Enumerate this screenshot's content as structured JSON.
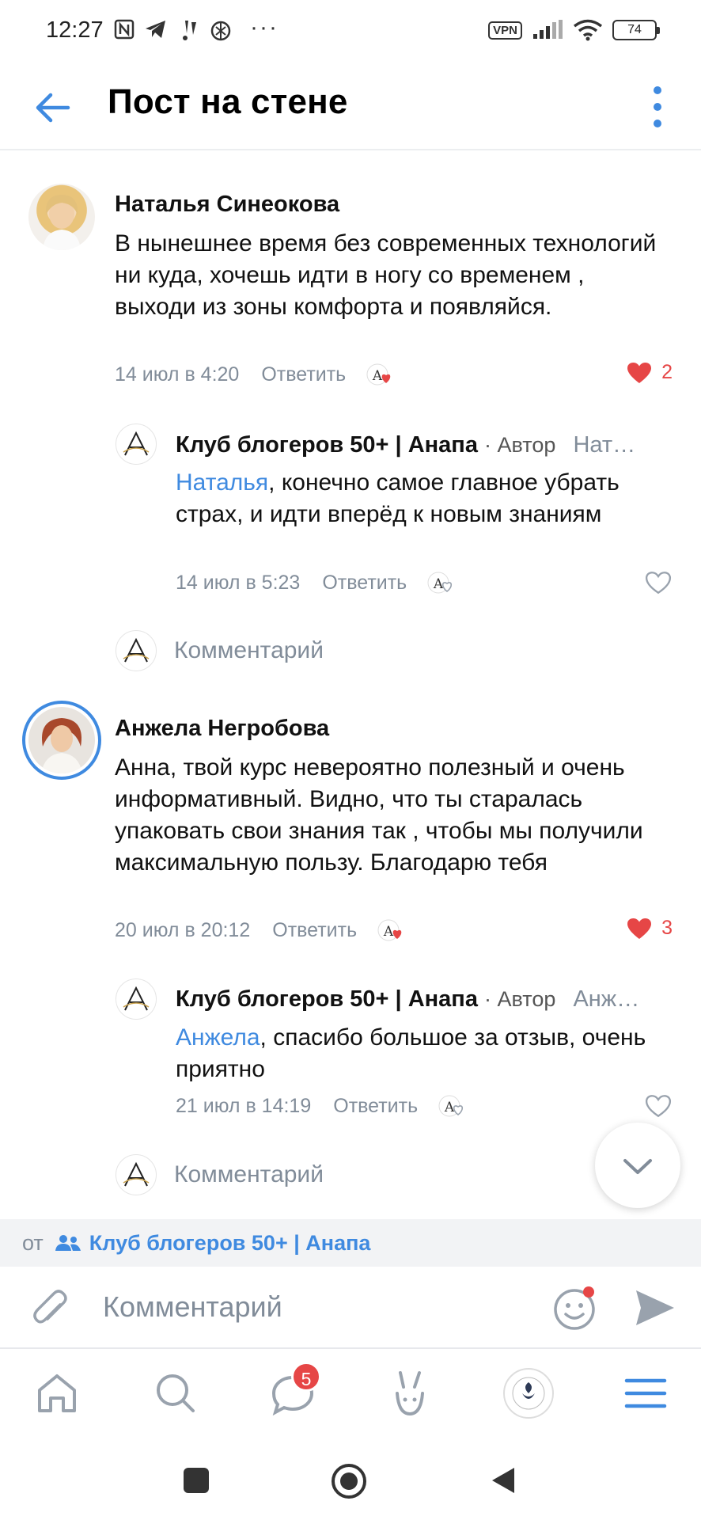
{
  "status_bar": {
    "time": "12:27",
    "vpn": "VPN",
    "battery": "74",
    "dots": "···"
  },
  "header": {
    "title": "Пост на стене"
  },
  "comments": [
    {
      "author": "Наталья Синеокова",
      "text": "В нынешнее время без современных технологий ни куда, хочешь идти в ногу со временем , выходи из зоны комфорта и появляйся.",
      "date": "14 июл в 4:20",
      "reply_label": "Ответить",
      "likes": "2",
      "reply": {
        "author": "Клуб блогеров 50+ | Анапа",
        "author_tag": "· Автор",
        "reply_to": "Нат…",
        "mention": "Наталья",
        "text": ", конечно самое главное убрать страх, и идти вперёд к новым знаниям",
        "date": "14 июл в 5:23",
        "reply_label": "Ответить"
      },
      "comment_placeholder": "Комментарий"
    },
    {
      "author": "Анжела Негробова",
      "text": "Анна, твой курс невероятно полезный и очень информативный. Видно, что ты старалась упаковать свои знания так , чтобы мы получили максимальную пользу. Благодарю тебя",
      "date": "20 июл в 20:12",
      "reply_label": "Ответить",
      "likes": "3",
      "reply": {
        "author": "Клуб блогеров 50+ | Анапа",
        "author_tag": "· Автор",
        "reply_to": "Анж…",
        "mention": "Анжела",
        "text": ", спасибо большое за отзыв, очень приятно",
        "date": "21 июл в 14:19",
        "reply_label": "Ответить"
      },
      "comment_placeholder": "Комментарий"
    }
  ],
  "from_bar": {
    "label": "от",
    "club": "Клуб блогеров 50+ | Анапа"
  },
  "composer": {
    "placeholder": "Комментарий"
  },
  "tabbar": {
    "messages_badge": "5"
  },
  "colors": {
    "accent": "#3f8ae0",
    "like": "#e64646",
    "secondary_text": "#818c99"
  }
}
